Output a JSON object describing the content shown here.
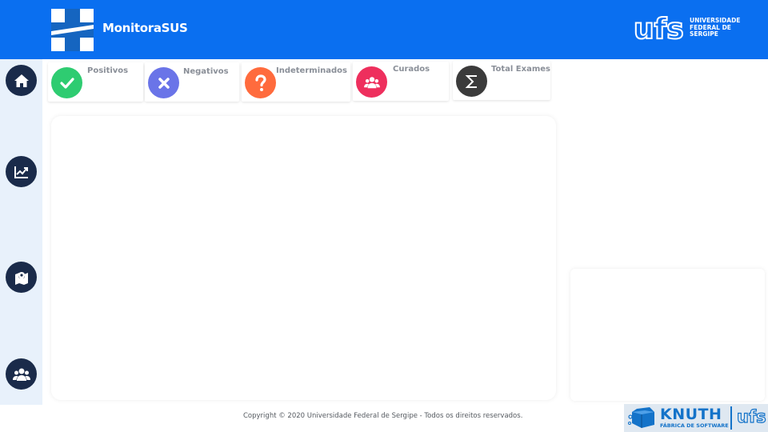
{
  "header": {
    "title": "MonitoraSUS",
    "institution": "UNIVERSIDADE FEDERAL DE SERGIPE",
    "institution_lines": [
      "UNIVERSIDADE",
      "FEDERAL DE",
      "SERGIPE"
    ],
    "institution_short": "ufs"
  },
  "sidebar": {
    "items": [
      {
        "icon": "home-icon"
      },
      {
        "icon": "chart-line-icon"
      },
      {
        "icon": "map-marker-icon"
      },
      {
        "icon": "users-icon"
      }
    ]
  },
  "cards": [
    {
      "label": "Positivos",
      "icon": "check-icon",
      "color": "#2ecc71"
    },
    {
      "label": "Negativos",
      "icon": "times-icon",
      "color": "#6a74e8"
    },
    {
      "label": "Indeterminados",
      "icon": "question-icon",
      "color": "#ff6b3d"
    },
    {
      "label": "Curados",
      "icon": "users-icon",
      "color": "#ee2f5d"
    },
    {
      "label": "Total Exames",
      "icon": "sigma-icon",
      "color": "#3b3b3b"
    }
  ],
  "footer": {
    "copyright": "Copyright © 2020 Universidade Federal de Sergipe - Todos os direitos reservados.",
    "knuth_title": "KNUTH",
    "knuth_subtitle": "FÁBRICA DE SOFTWARE",
    "ufs_short": "ufs"
  },
  "colors": {
    "header": "#0a6ff0",
    "sidebar": "#e8f1fb",
    "nav_button": "#1a2b4a"
  }
}
